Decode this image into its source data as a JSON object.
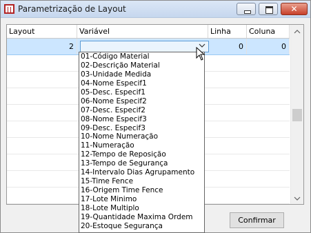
{
  "window": {
    "title": "Parametrização de Layout",
    "close_symbol": "✕",
    "icons": [
      "app-icon",
      "minimize-icon",
      "maximize-icon",
      "close-icon"
    ]
  },
  "grid": {
    "columns": [
      "Layout",
      "Variável",
      "Linha",
      "Coluna"
    ],
    "rows": [
      {
        "layout": "2",
        "variavel": "",
        "linha": "0",
        "coluna": "0"
      }
    ]
  },
  "dropdown": {
    "items": [
      "01-Código Material",
      "02-Descrição Material",
      "03-Unidade Medida",
      "04-Nome Especif1",
      "05-Desc. Especif1",
      "06-Nome Especif2",
      "07-Desc. Especif2",
      "08-Nome Especif3",
      "09-Desc. Especif3",
      "10-Nome Numeração",
      "11-Numeração",
      "12-Tempo de Reposição",
      "13-Tempo de Segurança",
      "14-Intervalo Dias Agrupamento",
      "15-Time Fence",
      "16-Origem Time Fence",
      "17-Lote Minimo",
      "18-Lote Multiplo",
      "19-Quantidade Maxima Ordem",
      "20-Estoque Segurança"
    ]
  },
  "footer": {
    "confirm_label": "Confirmar"
  },
  "colors": {
    "selected_row": "#cce6ff",
    "combo_border": "#5b9bd5",
    "close_button": "#c7402a"
  }
}
